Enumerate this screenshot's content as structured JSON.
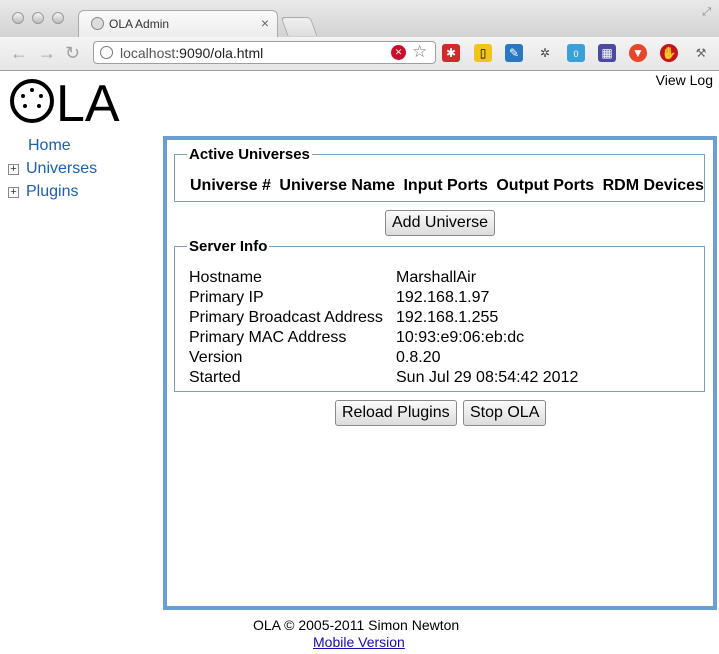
{
  "browser": {
    "tab_title": "OLA Admin",
    "tab_close": "×",
    "url_host": "localhost",
    "url_rest": ":9090/ola.html",
    "back": "←",
    "forward": "→",
    "reload": "↻",
    "resize_icon": "⤢",
    "extension_badge": "0"
  },
  "header": {
    "logo_text": "OLA",
    "view_log": "View Log"
  },
  "nav": {
    "home": "Home",
    "universes": "Universes",
    "plugins": "Plugins",
    "expand_symbol": "+"
  },
  "active_universes": {
    "legend": "Active Universes",
    "columns": [
      "Universe #",
      "Universe Name",
      "Input Ports",
      "Output Ports",
      "RDM Devices"
    ]
  },
  "buttons": {
    "add_universe": "Add Universe",
    "reload_plugins": "Reload Plugins",
    "stop_ola": "Stop OLA"
  },
  "server_info": {
    "legend": "Server Info",
    "rows": [
      {
        "label": "Hostname",
        "value": "MarshallAir"
      },
      {
        "label": "Primary IP",
        "value": "192.168.1.97"
      },
      {
        "label": "Primary Broadcast Address",
        "value": "192.168.1.255"
      },
      {
        "label": "Primary MAC Address",
        "value": "10:93:e9:06:eb:dc"
      },
      {
        "label": "Version",
        "value": "0.8.20"
      },
      {
        "label": "Started",
        "value": "Sun Jul 29 08:54:42 2012"
      }
    ]
  },
  "footer": {
    "copyright": "OLA © 2005-2011 Simon Newton",
    "mobile_link": "Mobile Version"
  },
  "colors": {
    "panel_border": "#6a9fd4",
    "link": "#1a5fb4",
    "fieldset_border": "#7a9fbf"
  }
}
